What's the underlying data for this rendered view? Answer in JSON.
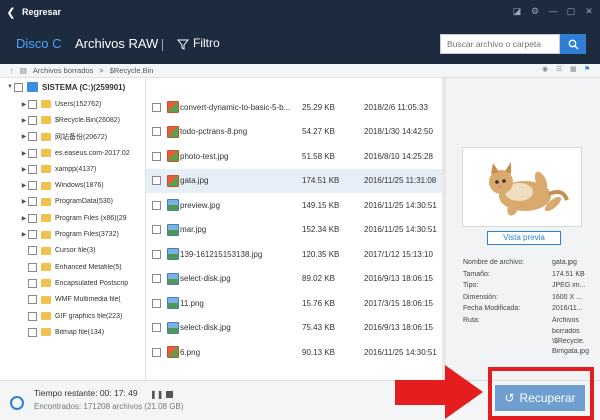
{
  "titlebar": {
    "back_label": "Regresar"
  },
  "tabs": [
    {
      "label": "Disco C"
    },
    {
      "label": "Archivos RAW"
    }
  ],
  "filter": {
    "label": "Filtro"
  },
  "search": {
    "placeholder": "Buscar archivo o carpeta"
  },
  "path": {
    "parts": [
      "Archivos borrados",
      ">",
      "$Recycle.Bin"
    ]
  },
  "tree": {
    "root_label": "SISTEMA (C:)(259901)",
    "items": [
      {
        "label": "Users(152762)",
        "expandable": true
      },
      {
        "label": "$Recycle.Bin(26082)",
        "expandable": true
      },
      {
        "label": "网站备份(20672)",
        "expandable": true
      },
      {
        "label": "es.easeus.com-2017.02",
        "expandable": true
      },
      {
        "label": "xampp(4137)",
        "expandable": true
      },
      {
        "label": "Windows(1876)",
        "expandable": true
      },
      {
        "label": "ProgramData(530)",
        "expandable": true
      },
      {
        "label": "Program Files (x86)(29",
        "expandable": true
      },
      {
        "label": "Program Files(3732)",
        "expandable": true
      },
      {
        "label": "Cursor file(3)",
        "expandable": false
      },
      {
        "label": "Enhanced Metafile(5)",
        "expandable": false
      },
      {
        "label": "Encapsulated Postscrip",
        "expandable": false
      },
      {
        "label": "WMF Multimedia file(",
        "expandable": false
      },
      {
        "label": "GIF graphics file(223)",
        "expandable": false
      },
      {
        "label": "Bitmap file(134)",
        "expandable": false
      }
    ]
  },
  "files": [
    {
      "name": "convert-dynamic-to-basic-5-b...",
      "size": "25.29 KB",
      "date": "2018/2/6 11:05:33",
      "type": "img",
      "selected": false
    },
    {
      "name": "todo-pctrans-8.png",
      "size": "54.27 KB",
      "date": "2018/1/30 14:42:50",
      "type": "img",
      "selected": false
    },
    {
      "name": "photo-test.jpg",
      "size": "51.58 KB",
      "date": "2016/8/10 14:25:28",
      "type": "img",
      "selected": false
    },
    {
      "name": "gata.jpg",
      "size": "174.51 KB",
      "date": "2016/11/25 11:31:08",
      "type": "img",
      "selected": true
    },
    {
      "name": "preview.jpg",
      "size": "149.15 KB",
      "date": "2016/11/25 14:30:51",
      "type": "pic",
      "selected": false
    },
    {
      "name": "mar.jpg",
      "size": "152.34 KB",
      "date": "2016/11/25 14:30:51",
      "type": "pic",
      "selected": false
    },
    {
      "name": "139-161215153138.jpg",
      "size": "120.35 KB",
      "date": "2017/1/12 15:13:10",
      "type": "pic",
      "selected": false
    },
    {
      "name": "select-disk.jpg",
      "size": "89.02 KB",
      "date": "2016/9/13 18:06:15",
      "type": "pic",
      "selected": false
    },
    {
      "name": "11.png",
      "size": "15.76 KB",
      "date": "2017/3/15 18:06:15",
      "type": "pic",
      "selected": false
    },
    {
      "name": "select-disk.jpg",
      "size": "75.43 KB",
      "date": "2016/9/13 18:06:15",
      "type": "pic",
      "selected": false
    },
    {
      "name": "6.png",
      "size": "90.13 KB",
      "date": "2016/11/25 14:30:51",
      "type": "img",
      "selected": false
    }
  ],
  "preview": {
    "button_label": "Vista previa",
    "fields": [
      {
        "label": "Nombre de archivo:",
        "value": "gata.jpg"
      },
      {
        "label": "Tamaño:",
        "value": "174.51 KB"
      },
      {
        "label": "Tipo:",
        "value": "JPEG im..."
      },
      {
        "label": "Dimensión:",
        "value": "1600 X ..."
      },
      {
        "label": "Fecha Modificada:",
        "value": "2016/11..."
      },
      {
        "label": "Ruta:",
        "value": "Archivos"
      }
    ],
    "path_lines": [
      "borrados",
      "\\$Recycle.",
      "Bin\\gata.jpg"
    ]
  },
  "status": {
    "time_label": "Tiempo restante: 00: 17: 49",
    "found_label": "Encontrados: 171208 archivos (21.08 GB)"
  },
  "recover": {
    "label": "Recuperar"
  },
  "colors": {
    "accent": "#2f7fd6",
    "titlebar": "#1c2b3d",
    "recover": "#6f9ed1",
    "highlight": "#e41e1e"
  }
}
